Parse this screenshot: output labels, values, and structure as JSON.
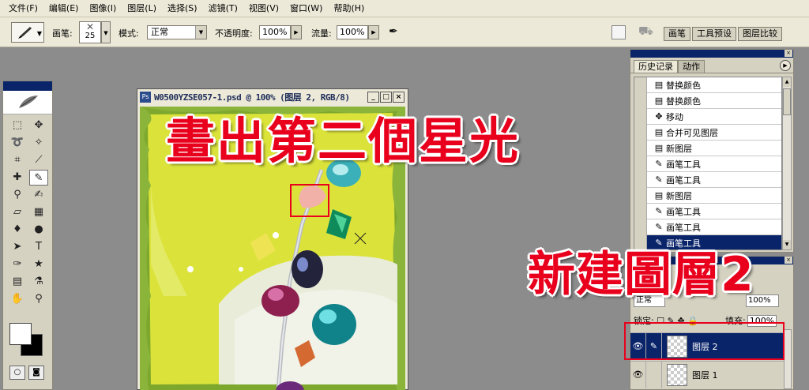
{
  "menu": [
    "文件(F)",
    "编辑(E)",
    "图像(I)",
    "图层(L)",
    "选择(S)",
    "滤镜(T)",
    "视图(V)",
    "窗口(W)",
    "帮助(H)"
  ],
  "options": {
    "brush_label": "画笔:",
    "brush_size": "25",
    "mode_label": "模式:",
    "mode_value": "正常",
    "opacity_label": "不透明度:",
    "opacity_value": "100%",
    "flow_label": "流量:",
    "flow_value": "100%",
    "palette_tabs": [
      "画笔",
      "工具预设",
      "图层比较"
    ]
  },
  "document": {
    "title": "W0500YZSE057-1.psd @ 100% (图层 2, RGB/8)",
    "win_buttons": [
      "_",
      "□",
      "×"
    ]
  },
  "history": {
    "tabs": [
      "历史记录",
      "动作"
    ],
    "items": [
      {
        "icon": "document-icon",
        "label": "替换颜色"
      },
      {
        "icon": "document-icon",
        "label": "替换颜色"
      },
      {
        "icon": "move-icon",
        "label": "移动"
      },
      {
        "icon": "document-icon",
        "label": "合并可见图层"
      },
      {
        "icon": "document-icon",
        "label": "新图层"
      },
      {
        "icon": "brush-icon",
        "label": "画笔工具"
      },
      {
        "icon": "brush-icon",
        "label": "画笔工具"
      },
      {
        "icon": "document-icon",
        "label": "新图层"
      },
      {
        "icon": "brush-icon",
        "label": "画笔工具"
      },
      {
        "icon": "brush-icon",
        "label": "画笔工具"
      },
      {
        "icon": "brush-icon",
        "label": "画笔工具",
        "selected": true
      }
    ]
  },
  "layers": {
    "blend_mode": "正常",
    "opacity_value": "100%",
    "lock_label": "锁定:",
    "fill_label": "填充:",
    "fill_value": "100%",
    "rows": [
      {
        "name": "图层 2",
        "active": true
      },
      {
        "name": "图层 1",
        "active": false
      }
    ]
  },
  "annotations": {
    "text1": "畫出第二個星光",
    "text2": "新建圖層2",
    "color": "#e8001c"
  }
}
